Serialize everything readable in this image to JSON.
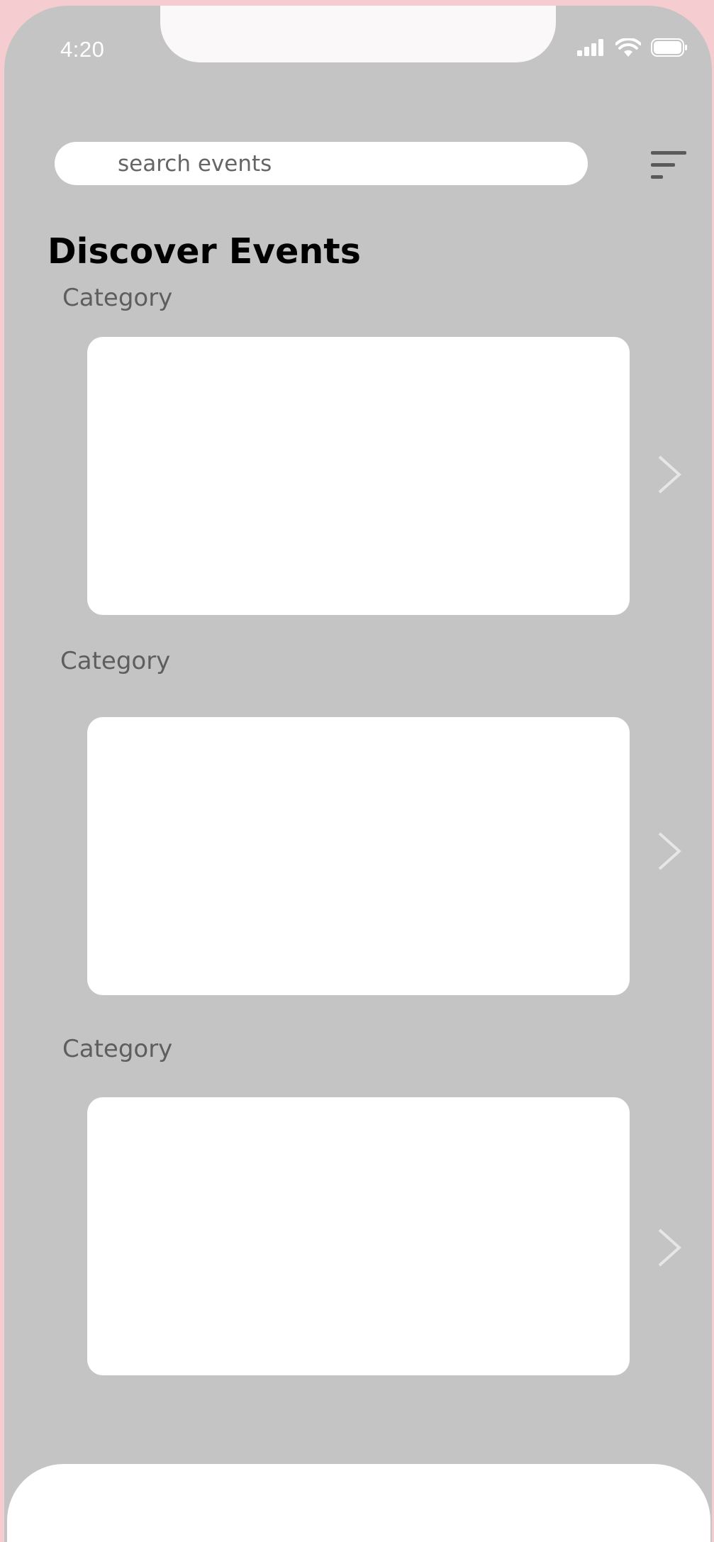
{
  "status_bar": {
    "time": "4:20"
  },
  "search": {
    "placeholder": "search events",
    "icon": "search-icon"
  },
  "filter": {
    "icon": "filter-menu-icon"
  },
  "page": {
    "title": "Discover Events"
  },
  "sections": [
    {
      "category": "Category",
      "next_icon": "chevron-right-icon"
    },
    {
      "category": "Category",
      "next_icon": "chevron-right-icon"
    },
    {
      "category": "Category",
      "next_icon": "chevron-right-icon"
    }
  ],
  "colors": {
    "screen_background": "#c4c4c4",
    "outer_background": "#f5cdd0",
    "card": "#ffffff",
    "label_text": "#5e5e5e",
    "title_text": "#000000",
    "chevron": "#e6e6e6"
  }
}
